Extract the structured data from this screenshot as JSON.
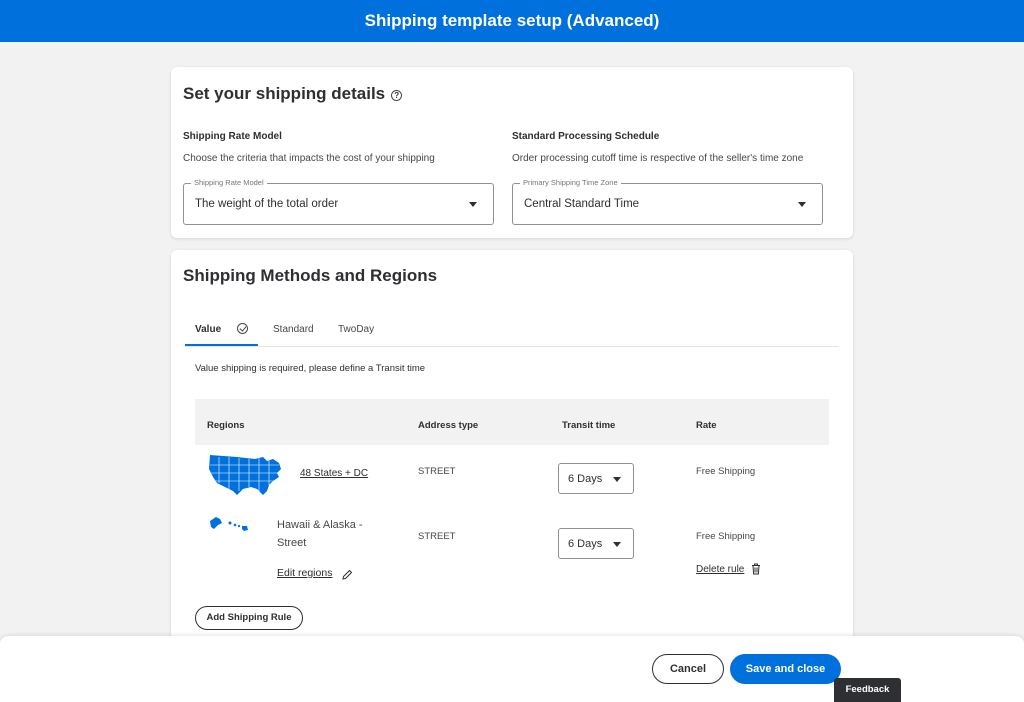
{
  "header": {
    "title": "Shipping template setup (Advanced)"
  },
  "details": {
    "title": "Set your shipping details",
    "help_icon": "?",
    "rate_model": {
      "label": "Shipping Rate Model",
      "description": "Choose the criteria that impacts the cost of your shipping",
      "field_legend": "Shipping Rate Model",
      "value": "The weight of the total order"
    },
    "processing": {
      "label": "Standard Processing Schedule",
      "description": "Order processing cutoff time is respective of the seller's time zone",
      "field_legend": "Primary Shipping Time Zone",
      "value": "Central Standard Time"
    }
  },
  "methods": {
    "title": "Shipping Methods and Regions",
    "tabs": [
      {
        "label": "Value",
        "active": true,
        "icon": "check-circle-icon"
      },
      {
        "label": "Standard",
        "active": false
      },
      {
        "label": "TwoDay",
        "active": false
      }
    ],
    "notice": "Value shipping is required, please define a Transit time",
    "table": {
      "headers": [
        "Regions",
        "Address type",
        "Transit time",
        "Rate"
      ],
      "rows": [
        {
          "region": "48 States + DC",
          "address_type": "STREET",
          "transit": "6 Days",
          "rate": "Free Shipping"
        },
        {
          "region": "Hawaii & Alaska - Street",
          "address_type": "STREET",
          "transit": "6 Days",
          "rate": "Free Shipping",
          "edit_label": "Edit regions",
          "delete_label": "Delete rule"
        }
      ]
    },
    "add_rule_label": "Add Shipping Rule"
  },
  "footer": {
    "cancel_label": "Cancel",
    "save_label": "Save and close"
  },
  "feedback_label": "Feedback",
  "colors": {
    "brand": "#0071dc",
    "text": "#2e2f32",
    "background": "#f2f2f2"
  }
}
